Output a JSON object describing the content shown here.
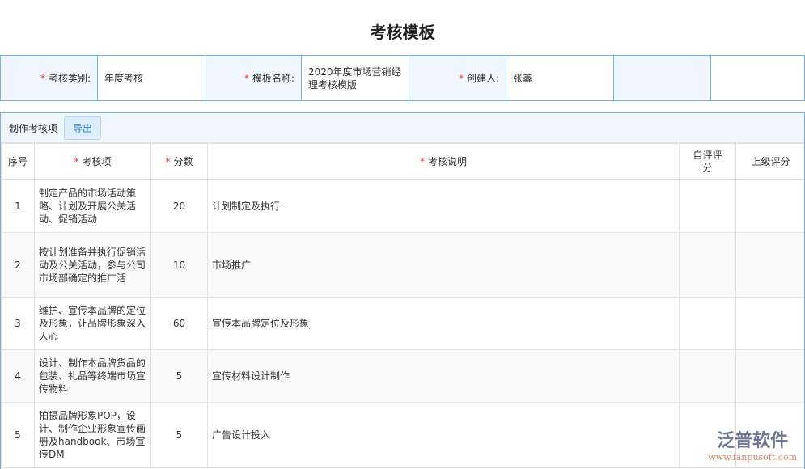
{
  "title": "考核模板",
  "form": {
    "category_label": "考核类别:",
    "category_value": "年度考核",
    "name_label": "模板名称:",
    "name_value": "2020年度市场营销经理考核模版",
    "creator_label": "创建人:",
    "creator_value": "张鑫"
  },
  "section": {
    "label": "制作考核项",
    "export_label": "导出"
  },
  "columns": {
    "no": "序号",
    "item": "考核项",
    "score": "分数",
    "desc": "考核说明",
    "self": "自评评分",
    "superior": "上级评分"
  },
  "rows": [
    {
      "no": "1",
      "item": "制定产品的市场活动策略、计划及开展公关活动、促销活动",
      "score": "20",
      "desc": "计划制定及执行"
    },
    {
      "no": "2",
      "item": "按计划准备并执行促销活动及公关活动，参与公司市场部确定的推广活",
      "score": "10",
      "desc": "市场推广"
    },
    {
      "no": "3",
      "item": "维护、宣传本品牌的定位及形象，让品牌形象深入人心",
      "score": "60",
      "desc": "宣传本品牌定位及形象"
    },
    {
      "no": "4",
      "item": "设计、制作本品牌货品的包装、礼品等终端市场宣传物料",
      "score": "5",
      "desc": "宣传材料设计制作"
    },
    {
      "no": "5",
      "item": "拍摄品牌形象POP，设计、制作企业形象宣传画册及handbook、市场宣传DM",
      "score": "5",
      "desc": "广告设计投入"
    }
  ],
  "logo": {
    "name": "泛普软件",
    "url": "www.fanpusoft.com"
  }
}
